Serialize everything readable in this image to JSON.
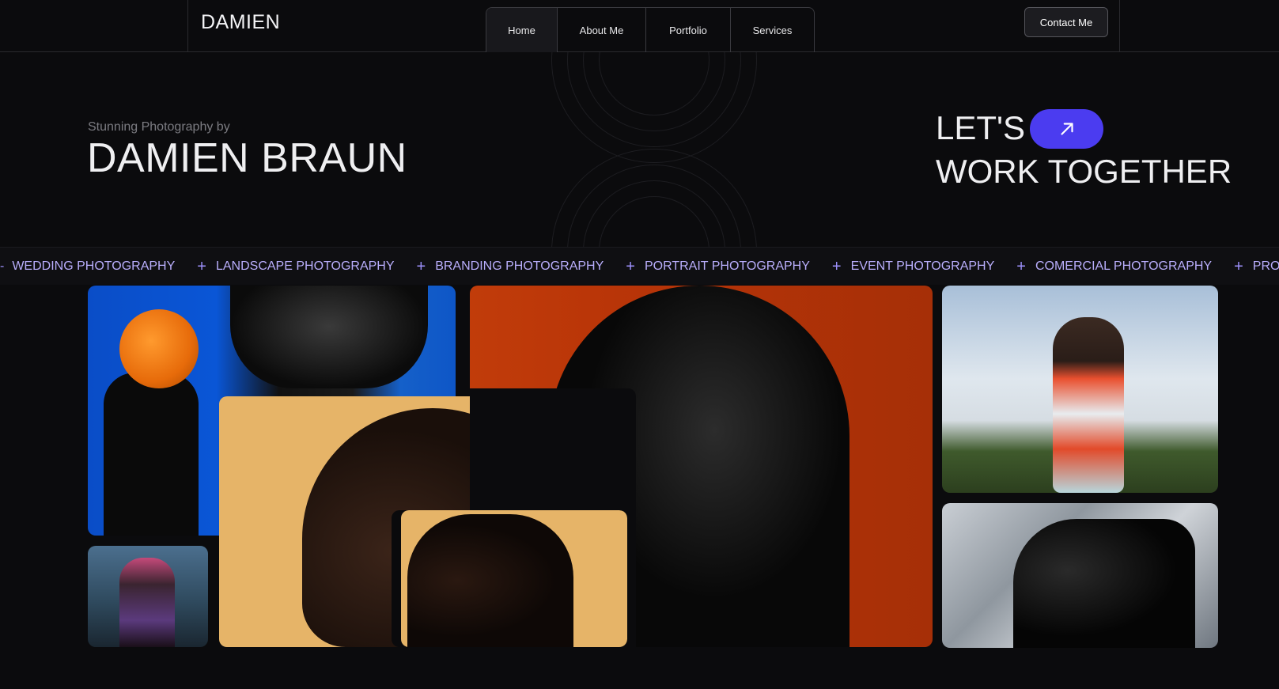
{
  "header": {
    "logo": "DAMIEN",
    "nav": [
      {
        "label": "Home",
        "active": true
      },
      {
        "label": "About Me",
        "active": false
      },
      {
        "label": "Portfolio",
        "active": false
      },
      {
        "label": "Services",
        "active": false
      }
    ],
    "contact_label": "Contact Me"
  },
  "hero": {
    "subtitle": "Stunning Photography by",
    "name": "DAMIEN BRAUN",
    "cta_line1": "LET'S",
    "cta_line2": "WORK TOGETHER",
    "cta_icon": "arrow-up-right-icon",
    "accent_color": "#4b3cf0"
  },
  "marquee": {
    "items": [
      "WEDDING PHOTOGRAPHY",
      "LANDSCAPE PHOTOGRAPHY",
      "BRANDING PHOTOGRAPHY",
      "PORTRAIT PHOTOGRAPHY",
      "EVENT PHOTOGRAPHY",
      "COMERCIAL PHOTOGRAPHY",
      "PRODUCT PHOTOGRAPHY"
    ],
    "color": "#b9aefc"
  }
}
